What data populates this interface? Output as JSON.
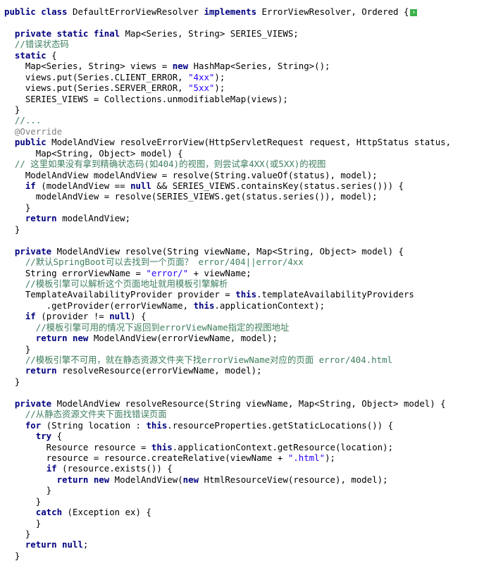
{
  "colors": {
    "kw": "#000080",
    "cmt": "#3f7f5f",
    "str": "#2a00ff",
    "ann": "#808080",
    "txt": "#000000",
    "background": "#ffffff",
    "collapse_icon": "#3cb34a"
  },
  "collapse_icon": {
    "name": "collapse-toggle-icon",
    "glyph": "›"
  },
  "lines": [
    [
      [
        "kw",
        "public class "
      ],
      [
        "txt",
        "DefaultErrorViewResolver "
      ],
      [
        "kw",
        "implements "
      ],
      [
        "txt",
        "ErrorViewResolver, Ordered {"
      ]
    ],
    [],
    [
      [
        "txt",
        "  "
      ],
      [
        "kw",
        "private static final "
      ],
      [
        "txt",
        "Map<Series, String> SERIES_VIEWS;"
      ]
    ],
    [
      [
        "cmt",
        "  //错误状态码"
      ]
    ],
    [
      [
        "txt",
        "  "
      ],
      [
        "kw",
        "static "
      ],
      [
        "txt",
        "{"
      ]
    ],
    [
      [
        "txt",
        "    Map<Series, String> views = "
      ],
      [
        "kw",
        "new "
      ],
      [
        "txt",
        "HashMap<Series, String>();"
      ]
    ],
    [
      [
        "txt",
        "    views.put(Series.CLIENT_ERROR, "
      ],
      [
        "str",
        "\"4xx\""
      ],
      [
        "txt",
        ");"
      ]
    ],
    [
      [
        "txt",
        "    views.put(Series.SERVER_ERROR, "
      ],
      [
        "str",
        "\"5xx\""
      ],
      [
        "txt",
        ");"
      ]
    ],
    [
      [
        "txt",
        "    SERIES_VIEWS = Collections.unmodifiableMap(views);"
      ]
    ],
    [
      [
        "txt",
        "  }"
      ]
    ],
    [
      [
        "cmt",
        "  //..."
      ]
    ],
    [
      [
        "ann",
        "  @Override"
      ]
    ],
    [
      [
        "txt",
        "  "
      ],
      [
        "kw",
        "public "
      ],
      [
        "txt",
        "ModelAndView resolveErrorView(HttpServletRequest request, HttpStatus status,"
      ]
    ],
    [
      [
        "txt",
        "      Map<String, Object> model) {"
      ]
    ],
    [
      [
        "cmt",
        "  // 这里如果没有拿到精确状态码(如404)的视图，则尝试拿4XX(或5XX)的视图"
      ]
    ],
    [
      [
        "txt",
        "    ModelAndView modelAndView = resolve(String.valueOf(status), model);"
      ]
    ],
    [
      [
        "txt",
        "    "
      ],
      [
        "kw",
        "if "
      ],
      [
        "txt",
        "(modelAndView == "
      ],
      [
        "kw",
        "null "
      ],
      [
        "txt",
        "&& SERIES_VIEWS.containsKey(status.series())) {"
      ]
    ],
    [
      [
        "txt",
        "      modelAndView = resolve(SERIES_VIEWS.get(status.series()), model);"
      ]
    ],
    [
      [
        "txt",
        "    }"
      ]
    ],
    [
      [
        "txt",
        "    "
      ],
      [
        "kw",
        "return "
      ],
      [
        "txt",
        "modelAndView;"
      ]
    ],
    [
      [
        "txt",
        "  }"
      ]
    ],
    [],
    [
      [
        "txt",
        "  "
      ],
      [
        "kw",
        "private "
      ],
      [
        "txt",
        "ModelAndView resolve(String viewName, Map<String, Object> model) {"
      ]
    ],
    [
      [
        "cmt",
        "    //默认SpringBoot可以去找到一个页面？ error/404||error/4xx"
      ]
    ],
    [
      [
        "txt",
        "    String errorViewName = "
      ],
      [
        "str",
        "\"error/\" "
      ],
      [
        "txt",
        "+ viewName;"
      ]
    ],
    [
      [
        "cmt",
        "    //模板引擎可以解析这个页面地址就用模板引擎解析"
      ]
    ],
    [
      [
        "txt",
        "    TemplateAvailabilityProvider provider = "
      ],
      [
        "kw",
        "this"
      ],
      [
        "txt",
        ".templateAvailabilityProviders"
      ]
    ],
    [
      [
        "txt",
        "        .getProvider(errorViewName, "
      ],
      [
        "kw",
        "this"
      ],
      [
        "txt",
        ".applicationContext);"
      ]
    ],
    [
      [
        "txt",
        "    "
      ],
      [
        "kw",
        "if "
      ],
      [
        "txt",
        "(provider != "
      ],
      [
        "kw",
        "null"
      ],
      [
        "txt",
        ") {"
      ]
    ],
    [
      [
        "cmt",
        "      //模板引擎可用的情况下返回到errorViewName指定的视图地址"
      ]
    ],
    [
      [
        "txt",
        "      "
      ],
      [
        "kw",
        "return new "
      ],
      [
        "txt",
        "ModelAndView(errorViewName, model);"
      ]
    ],
    [
      [
        "txt",
        "    }"
      ]
    ],
    [
      [
        "cmt",
        "    //模板引擎不可用，就在静态资源文件夹下找errorViewName对应的页面 error/404.html"
      ]
    ],
    [
      [
        "txt",
        "    "
      ],
      [
        "kw",
        "return "
      ],
      [
        "txt",
        "resolveResource(errorViewName, model);"
      ]
    ],
    [
      [
        "txt",
        "  }"
      ]
    ],
    [],
    [
      [
        "txt",
        "  "
      ],
      [
        "kw",
        "private "
      ],
      [
        "txt",
        "ModelAndView resolveResource(String viewName, Map<String, Object> model) {"
      ]
    ],
    [
      [
        "cmt",
        "    //从静态资源文件夹下面找错误页面"
      ]
    ],
    [
      [
        "txt",
        "    "
      ],
      [
        "kw",
        "for "
      ],
      [
        "txt",
        "(String location : "
      ],
      [
        "kw",
        "this"
      ],
      [
        "txt",
        ".resourceProperties.getStaticLocations()) {"
      ]
    ],
    [
      [
        "txt",
        "      "
      ],
      [
        "kw",
        "try "
      ],
      [
        "txt",
        "{"
      ]
    ],
    [
      [
        "txt",
        "        Resource resource = "
      ],
      [
        "kw",
        "this"
      ],
      [
        "txt",
        ".applicationContext.getResource(location);"
      ]
    ],
    [
      [
        "txt",
        "        resource = resource.createRelative(viewName + "
      ],
      [
        "str",
        "\".html\""
      ],
      [
        "txt",
        ");"
      ]
    ],
    [
      [
        "txt",
        "        "
      ],
      [
        "kw",
        "if "
      ],
      [
        "txt",
        "(resource.exists()) {"
      ]
    ],
    [
      [
        "txt",
        "          "
      ],
      [
        "kw",
        "return new "
      ],
      [
        "txt",
        "ModelAndView("
      ],
      [
        "kw",
        "new "
      ],
      [
        "txt",
        "HtmlResourceView(resource), model);"
      ]
    ],
    [
      [
        "txt",
        "        }"
      ]
    ],
    [
      [
        "txt",
        "      }"
      ]
    ],
    [
      [
        "txt",
        "      "
      ],
      [
        "kw",
        "catch "
      ],
      [
        "txt",
        "(Exception ex) {"
      ]
    ],
    [
      [
        "txt",
        "      }"
      ]
    ],
    [
      [
        "txt",
        "    }"
      ]
    ],
    [
      [
        "txt",
        "    "
      ],
      [
        "kw",
        "return null"
      ],
      [
        "txt",
        ";"
      ]
    ],
    [
      [
        "txt",
        "  }"
      ]
    ]
  ]
}
